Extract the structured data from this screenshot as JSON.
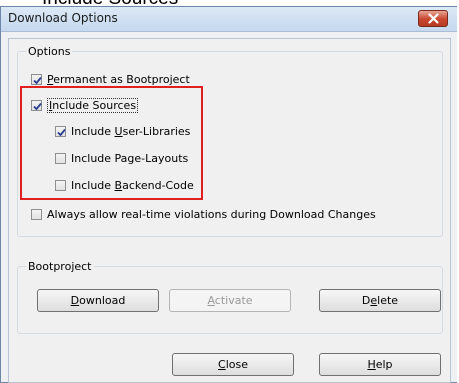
{
  "caption": "Include Sources",
  "window": {
    "title": "Download Options"
  },
  "options_group": {
    "title": "Options",
    "items": [
      {
        "label_pre": "",
        "label_u": "P",
        "label_post": "ermanent as Bootproject",
        "checked": true
      },
      {
        "label_pre": "",
        "label_u": "I",
        "label_post": "nclude Sources",
        "checked": true
      },
      {
        "label_pre": "Include ",
        "label_u": "U",
        "label_post": "ser-Libraries",
        "checked": true
      },
      {
        "label_pre": "Include Page-Layouts",
        "label_u": "",
        "label_post": "",
        "checked": false
      },
      {
        "label_pre": "Include ",
        "label_u": "B",
        "label_post": "ackend-Code",
        "checked": false
      },
      {
        "label_pre": "Always allow real-time violations during Download Changes",
        "label_u": "",
        "label_post": "",
        "checked": false
      }
    ]
  },
  "bootproject_group": {
    "title": "Bootproject",
    "download": {
      "u": "D",
      "rest": "ownload"
    },
    "activate": {
      "u": "A",
      "rest": "ctivate"
    },
    "delete": {
      "pre": "D",
      "u": "e",
      "rest": "lete"
    }
  },
  "footer": {
    "close": {
      "u": "C",
      "rest": "lose"
    },
    "help": {
      "u": "H",
      "rest": "elp"
    }
  },
  "colors": {
    "highlight": "#e02020",
    "close_button": "#c8462f"
  }
}
